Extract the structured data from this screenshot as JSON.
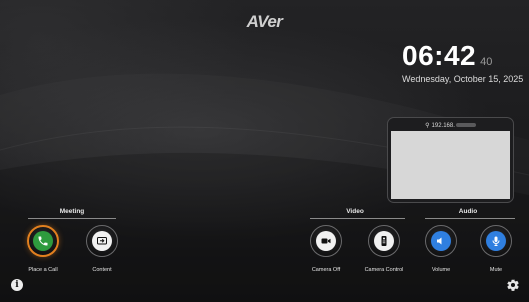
{
  "logo": "AVer",
  "clock": {
    "time": "06:42",
    "seconds": "40"
  },
  "date": "Wednesday, October 15, 2025",
  "preview": {
    "ip_prefix": "192.168."
  },
  "groups": {
    "meeting": "Meeting",
    "video": "Video",
    "audio": "Audio"
  },
  "buttons": {
    "place_call": "Place a Call",
    "content": "Content",
    "camera_off": "Camera Off",
    "camera_control": "Camera Control",
    "volume": "Volume",
    "mute": "Mute"
  },
  "icons": {
    "place_call": "phone-icon",
    "content": "screen-share-icon",
    "camera_off": "video-camera-icon",
    "camera_control": "remote-control-icon",
    "volume": "speaker-icon",
    "mute": "microphone-icon",
    "info": "info-icon",
    "settings": "gear-icon"
  },
  "colors": {
    "call_ring": "#e2801f",
    "call_icon": "#2e9b3e",
    "audio_icon": "#2f7fe0"
  }
}
